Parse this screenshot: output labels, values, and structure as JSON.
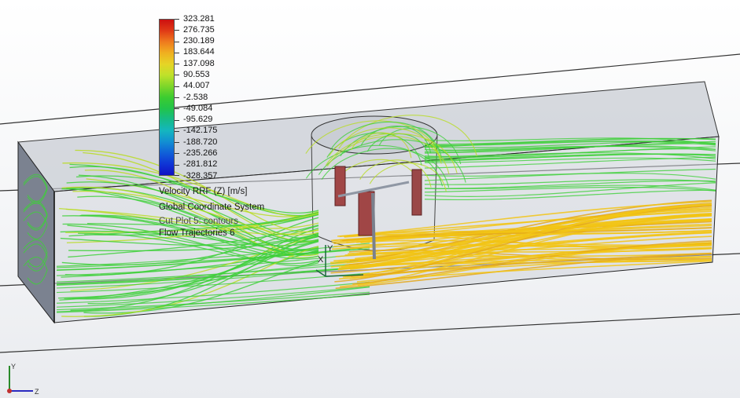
{
  "legend": {
    "ticks": [
      "323.281",
      "276.735",
      "230.189",
      "183.644",
      "137.098",
      "90.553",
      "44.007",
      "-2.538",
      "-49.084",
      "-95.629",
      "-142.175",
      "-188.720",
      "-235.266",
      "-281.812",
      "-328.357"
    ],
    "gradient": [
      "#cc1010",
      "#e03a16",
      "#ef7a1e",
      "#f0b020",
      "#e6d426",
      "#bfe12a",
      "#7ed62a",
      "#3ccc30",
      "#22c44a",
      "#16bb88",
      "#14b6bf",
      "#128fd2",
      "#1060d8",
      "#0f35d6",
      "#1010c4"
    ],
    "quantity": "Velocity RRF (Z) [m/s]",
    "coordinate_system": "Global Coordinate System",
    "plot_name": "Cut Plot 5: contours",
    "trajectories_name": "Flow Trajectories 6"
  },
  "axes": {
    "x": "X",
    "y": "Y",
    "z": "Z"
  },
  "colors": {
    "fast": "#f2c414",
    "medium": "#b8dc22",
    "slow": "#3ed03a",
    "blade": "#a04646",
    "duct": "#8f97a4"
  }
}
